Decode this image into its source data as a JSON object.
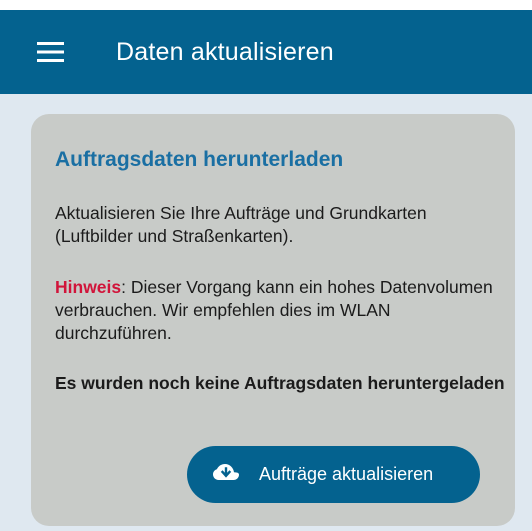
{
  "app_bar": {
    "title": "Daten aktualisieren",
    "menu_icon": "hamburger-menu-icon",
    "background": "#04628f"
  },
  "card": {
    "title": "Auftragsdaten herunterladen",
    "description": "Aktualisieren Sie Ihre Aufträge und Grundkarten (Luftbilder und Straßenkarten).",
    "hint_label": "Hinweis",
    "hint_text": ": Dieser Vorgang kann ein hohes Datenvolumen verbrauchen. Wir empfehlen dies im WLAN durchzuführen.",
    "status": "Es wurden noch keine Auftragsdaten heruntergeladen",
    "button": {
      "label": "Aufträge aktualisieren",
      "icon": "cloud-download-icon"
    }
  },
  "colors": {
    "primary": "#04628f",
    "title_blue": "#1a6fa3",
    "hint_red": "#d1143a",
    "card_bg": "#c8cbc8",
    "page_bg": "#dfe8f0"
  }
}
